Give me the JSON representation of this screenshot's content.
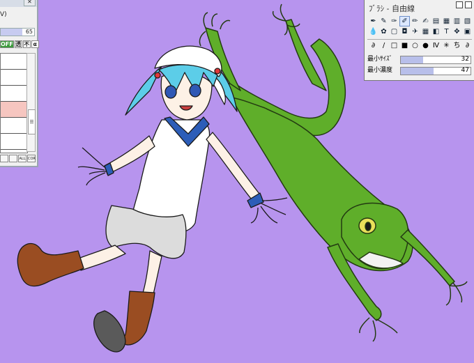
{
  "left_panel": {
    "menu_fragment": "V)",
    "opacity": {
      "value": "65",
      "fraction": 0.65
    },
    "toggle_buttons": [
      "OFF",
      "透",
      "不",
      "α"
    ],
    "layer_count": 6,
    "active_layer_index": 3,
    "bottom_buttons": [
      "",
      "",
      "ALL",
      "COR"
    ]
  },
  "brush_panel": {
    "title": "ﾌﾞﾗｼ - 自由線",
    "tool_icons": [
      "✒",
      "✎",
      "✑",
      "✐",
      "✏",
      "✍",
      "▤",
      "▦",
      "▥",
      "▧",
      "💧",
      "✿",
      "▢",
      "◘",
      "✈",
      "▦",
      "◧",
      "T",
      "✥",
      "▣"
    ],
    "selected_tool_index": 3,
    "shape_icons": [
      "∂",
      "/",
      "□",
      "■",
      "○",
      "●",
      "Ⅳ",
      "✳",
      "ち",
      "∂"
    ],
    "sliders": [
      {
        "label": "最小ｻｲｽﾞ",
        "value": "32",
        "fraction": 0.32
      },
      {
        "label": "最小濃度",
        "value": "47",
        "fraction": 0.47
      }
    ]
  },
  "colors": {
    "canvas_background": "#b794ee",
    "frog_green": "#5fae2a",
    "hair_cyan": "#5ccde8",
    "boot_brown": "#9a4d22"
  }
}
